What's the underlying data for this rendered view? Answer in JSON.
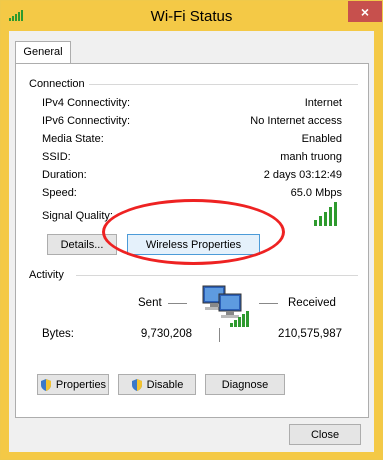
{
  "window": {
    "title": "Wi-Fi Status",
    "close_label": "×"
  },
  "tab": {
    "label": "General"
  },
  "connection": {
    "heading": "Connection",
    "rows": [
      {
        "key": "IPv4 Connectivity:",
        "value": "Internet"
      },
      {
        "key": "IPv6 Connectivity:",
        "value": "No Internet access"
      },
      {
        "key": "Media State:",
        "value": "Enabled"
      },
      {
        "key": "SSID:",
        "value": "manh truong"
      },
      {
        "key": "Duration:",
        "value": "2 days 03:12:49"
      },
      {
        "key": "Speed:",
        "value": "65.0 Mbps"
      }
    ],
    "signal_label": "Signal Quality:",
    "details_button": "Details...",
    "wireless_button": "Wireless Properties"
  },
  "activity": {
    "heading": "Activity",
    "sent_label": "Sent",
    "received_label": "Received",
    "bytes_label": "Bytes:",
    "bytes_sent": "9,730,208",
    "bytes_received": "210,575,987"
  },
  "buttons": {
    "properties": "Properties",
    "disable": "Disable",
    "diagnose": "Diagnose",
    "close": "Close"
  },
  "colors": {
    "accent_frame": "#f4c946",
    "signal_green": "#2e9a2e",
    "highlight_red": "#e22222"
  }
}
